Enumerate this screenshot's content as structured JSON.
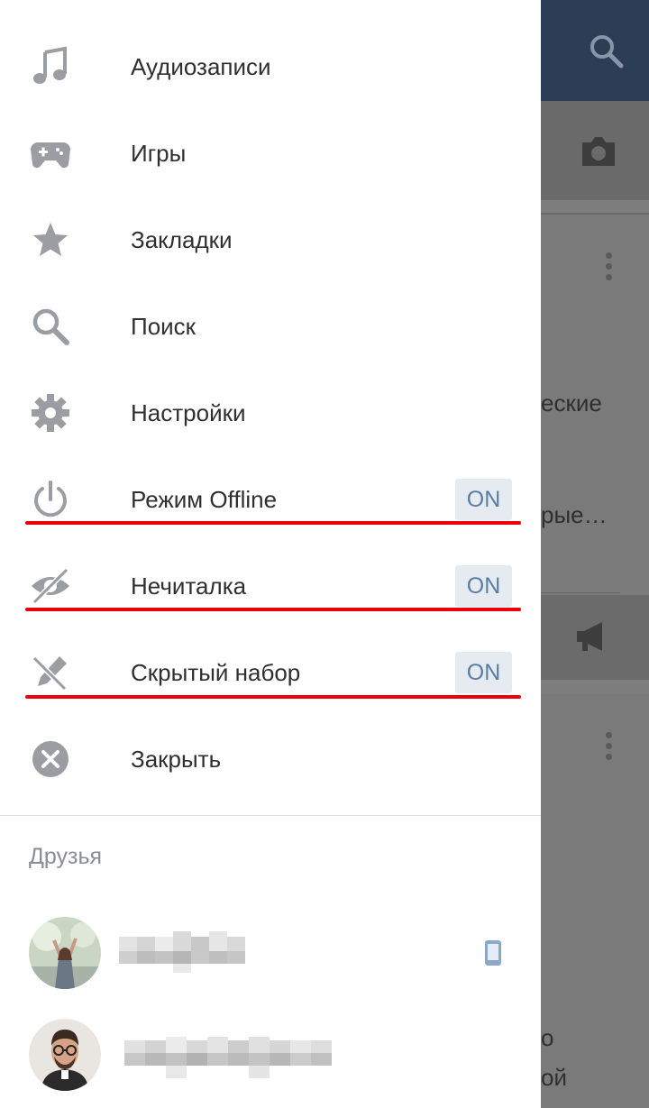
{
  "background": {
    "partial_text_1": "еские",
    "partial_text_2": "рые…",
    "partial_text_3": "о",
    "partial_text_4": "ой"
  },
  "menu": {
    "items": [
      {
        "label": "Аудиозаписи",
        "icon": "music-note-icon"
      },
      {
        "label": "Игры",
        "icon": "gamepad-icon"
      },
      {
        "label": "Закладки",
        "icon": "star-icon"
      },
      {
        "label": "Поиск",
        "icon": "search-icon"
      },
      {
        "label": "Настройки",
        "icon": "gear-icon"
      },
      {
        "label": "Режим Offline",
        "icon": "power-icon",
        "toggle": "ON"
      },
      {
        "label": "Нечиталка",
        "icon": "eye-off-icon",
        "toggle": "ON"
      },
      {
        "label": "Скрытый набор",
        "icon": "pencil-off-icon",
        "toggle": "ON"
      },
      {
        "label": "Закрыть",
        "icon": "close-circle-icon"
      }
    ]
  },
  "friends": {
    "title": "Друзья",
    "list": [
      {
        "name_hidden": true,
        "status_icon": "mobile-phone-icon"
      },
      {
        "name_hidden": true
      }
    ]
  },
  "colors": {
    "toolbar": "#2b3e56",
    "accent": "#5a7da0",
    "highlight_underline": "#e8000c",
    "toggle_bg": "#e5ebf1"
  }
}
